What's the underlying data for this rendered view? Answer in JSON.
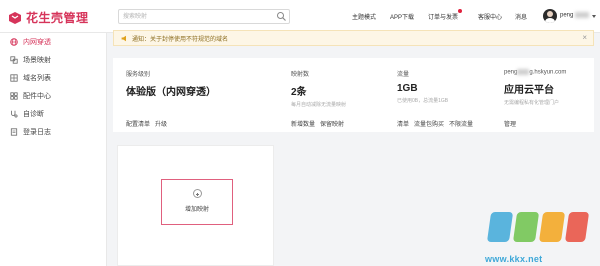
{
  "app": {
    "brand": "花生壳管理",
    "brand_color": "#d6345a"
  },
  "search": {
    "placeholder": "搜索映射"
  },
  "nav": {
    "items": [
      "主题模式",
      "APP下载",
      "订单与发票",
      "客服中心",
      "消息"
    ],
    "notification_dot_on": "订单与发票"
  },
  "user": {
    "name": "peng"
  },
  "sidebar": {
    "items": [
      {
        "label": "内网穿透",
        "icon": "globe-icon",
        "active": true
      },
      {
        "label": "场景映射",
        "icon": "layers-icon",
        "active": false
      },
      {
        "label": "域名列表",
        "icon": "grid-icon",
        "active": false
      },
      {
        "label": "配件中心",
        "icon": "blocks-icon",
        "active": false
      },
      {
        "label": "自诊断",
        "icon": "stethoscope-icon",
        "active": false
      },
      {
        "label": "登录日志",
        "icon": "document-icon",
        "active": false
      }
    ]
  },
  "notice": {
    "text": "通知：关于封停使用不符规范的域名",
    "close": "×"
  },
  "info": {
    "service": {
      "label": "服务级别",
      "value": "体验版（内网穿透）",
      "links": [
        "配置清单",
        "升级"
      ]
    },
    "mappings": {
      "label": "映射数",
      "value": "2条",
      "sub": "每月自动减除无流量映射",
      "links": [
        "新增数量",
        "保留映射"
      ]
    },
    "traffic": {
      "label": "流量",
      "value": "1GB",
      "sub": "已使用0B，总流量1GB",
      "links": [
        "清单",
        "流量包购买",
        "不限流量"
      ]
    },
    "account": {
      "label_prefix": "peng",
      "label_suffix": "g.hskyun.com",
      "value": "应用云平台",
      "sub": "无需编程私有化管理门户",
      "links": [
        "管理"
      ]
    }
  },
  "mapping_card": {
    "add_label": "增加映射"
  },
  "watermark": {
    "site": "www.kkx.net"
  }
}
